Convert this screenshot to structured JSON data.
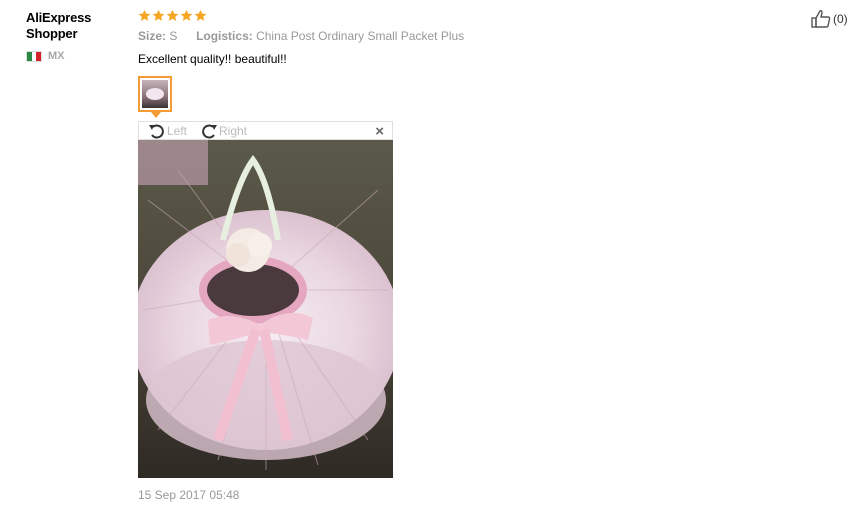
{
  "review": {
    "user_name": "AliExpress Shopper",
    "country_code": "MX",
    "rating": 5,
    "size_label": "Size:",
    "size_value": "S",
    "logistics_label": "Logistics:",
    "logistics_value": "China Post Ordinary Small Packet Plus",
    "text": "Excellent quality!! beautiful!!",
    "date": "15 Sep 2017 05:48",
    "likes": "(0)"
  },
  "viewer": {
    "rotate_left_label": "Left",
    "rotate_right_label": "Right",
    "close_symbol": "×"
  },
  "icons": {
    "star": "star-icon",
    "rotate_left": "rotate-left-icon",
    "rotate_right": "rotate-right-icon",
    "close": "close-icon",
    "thumbs_up": "thumbs-up-icon",
    "flag": "mexico-flag-icon"
  },
  "colors": {
    "star": "#f6a623",
    "thumb_border": "#f39c33",
    "muted_text": "#999999",
    "flag_green": "#2a8a43",
    "flag_red": "#d2232a"
  }
}
